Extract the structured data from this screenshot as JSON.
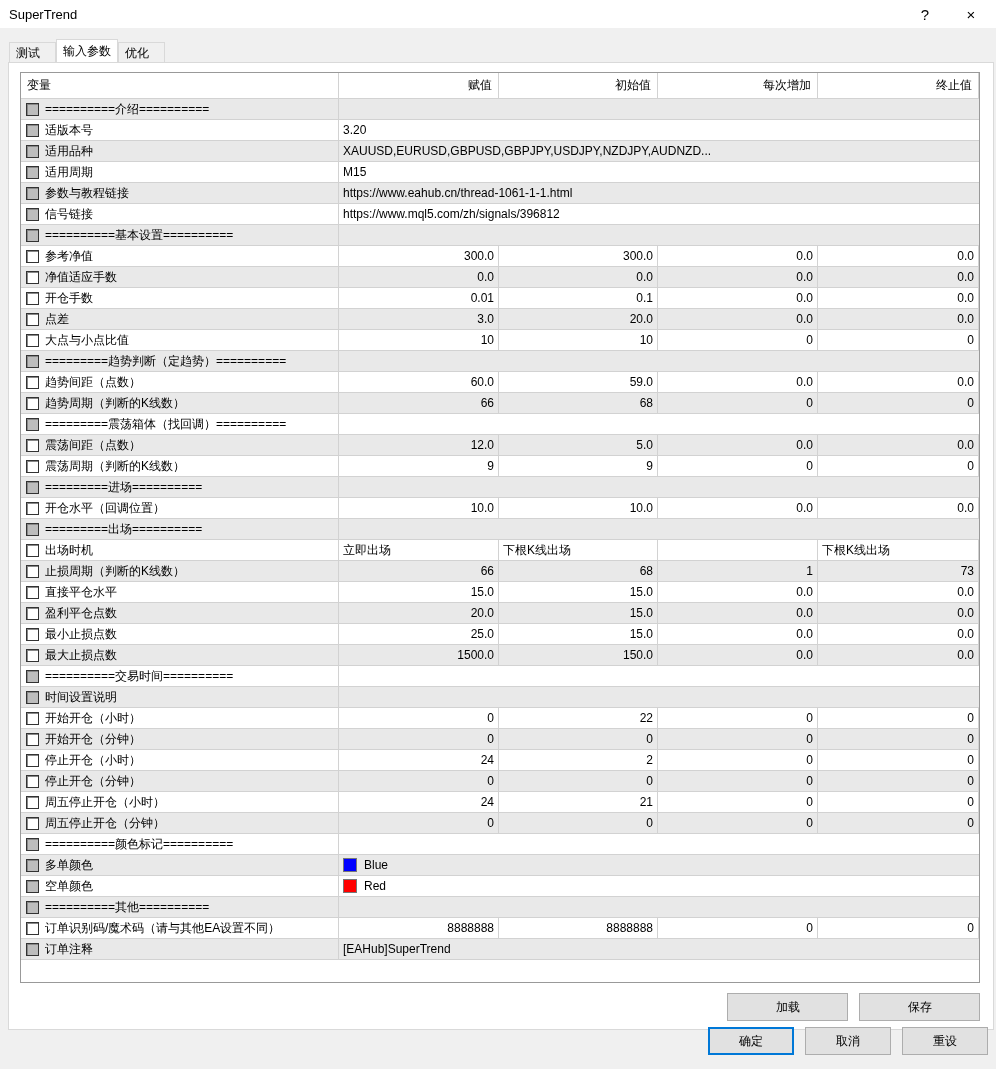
{
  "window": {
    "title": "SuperTrend",
    "help": "?",
    "close": "×"
  },
  "tabs": [
    {
      "label": "测试",
      "selected": false
    },
    {
      "label": "输入参数",
      "selected": true
    },
    {
      "label": "优化",
      "selected": false
    }
  ],
  "table": {
    "columns": [
      "变量",
      "赋值",
      "初始值",
      "每次增加",
      "终止值"
    ],
    "rows": [
      {
        "kind": "separator",
        "name": "==========介绍==========",
        "disabled": true
      },
      {
        "kind": "text",
        "name": "适版本号",
        "disabled": true,
        "value": "3.20"
      },
      {
        "kind": "text",
        "name": "适用品种",
        "disabled": true,
        "value": "XAUUSD,EURUSD,GBPUSD,GBPJPY,USDJPY,NZDJPY,AUDNZD..."
      },
      {
        "kind": "text",
        "name": "适用周期",
        "disabled": true,
        "value": "M15"
      },
      {
        "kind": "text",
        "name": "参数与教程链接",
        "disabled": true,
        "value": "https://www.eahub.cn/thread-1061-1-1.html"
      },
      {
        "kind": "text",
        "name": "信号链接",
        "disabled": true,
        "value": "https://www.mql5.com/zh/signals/396812"
      },
      {
        "kind": "separator",
        "name": "==========基本设置==========",
        "disabled": true
      },
      {
        "kind": "number",
        "name": "参考净值",
        "disabled": false,
        "values": [
          "300.0",
          "300.0",
          "0.0",
          "0.0"
        ]
      },
      {
        "kind": "number",
        "name": "净值适应手数",
        "disabled": false,
        "values": [
          "0.0",
          "0.0",
          "0.0",
          "0.0"
        ]
      },
      {
        "kind": "number",
        "name": "开仓手数",
        "disabled": false,
        "values": [
          "0.01",
          "0.1",
          "0.0",
          "0.0"
        ]
      },
      {
        "kind": "number",
        "name": "点差",
        "disabled": false,
        "values": [
          "3.0",
          "20.0",
          "0.0",
          "0.0"
        ]
      },
      {
        "kind": "number",
        "name": "大点与小点比值",
        "disabled": false,
        "values": [
          "10",
          "10",
          "0",
          "0"
        ]
      },
      {
        "kind": "separator",
        "name": "=========趋势判断（定趋势）==========",
        "disabled": true
      },
      {
        "kind": "number",
        "name": "趋势间距（点数）",
        "disabled": false,
        "values": [
          "60.0",
          "59.0",
          "0.0",
          "0.0"
        ]
      },
      {
        "kind": "number",
        "name": "趋势周期（判断的K线数）",
        "disabled": false,
        "values": [
          "66",
          "68",
          "0",
          "0"
        ]
      },
      {
        "kind": "separator",
        "name": "=========震荡箱体（找回调）==========",
        "disabled": true
      },
      {
        "kind": "number",
        "name": "震荡间距（点数）",
        "disabled": false,
        "values": [
          "12.0",
          "5.0",
          "0.0",
          "0.0"
        ]
      },
      {
        "kind": "number",
        "name": "震荡周期（判断的K线数）",
        "disabled": false,
        "values": [
          "9",
          "9",
          "0",
          "0"
        ]
      },
      {
        "kind": "separator",
        "name": "=========进场==========",
        "disabled": true
      },
      {
        "kind": "number",
        "name": "开仓水平（回调位置）",
        "disabled": false,
        "values": [
          "10.0",
          "10.0",
          "0.0",
          "0.0"
        ]
      },
      {
        "kind": "separator",
        "name": "=========出场==========",
        "disabled": true
      },
      {
        "kind": "choice",
        "name": "出场时机",
        "disabled": false,
        "values": {
          "assigned": "立即出场",
          "initial": "下根K线出场",
          "final": "下根K线出场"
        }
      },
      {
        "kind": "number",
        "name": "止损周期（判断的K线数）",
        "disabled": false,
        "values": [
          "66",
          "68",
          "1",
          "73"
        ]
      },
      {
        "kind": "number",
        "name": "直接平仓水平",
        "disabled": false,
        "values": [
          "15.0",
          "15.0",
          "0.0",
          "0.0"
        ]
      },
      {
        "kind": "number",
        "name": "盈利平仓点数",
        "disabled": false,
        "values": [
          "20.0",
          "15.0",
          "0.0",
          "0.0"
        ]
      },
      {
        "kind": "number",
        "name": "最小止损点数",
        "disabled": false,
        "values": [
          "25.0",
          "15.0",
          "0.0",
          "0.0"
        ]
      },
      {
        "kind": "number",
        "name": "最大止损点数",
        "disabled": false,
        "values": [
          "1500.0",
          "150.0",
          "0.0",
          "0.0"
        ]
      },
      {
        "kind": "separator",
        "name": "==========交易时间==========",
        "disabled": true
      },
      {
        "kind": "separator",
        "name": "时间设置说明",
        "disabled": true
      },
      {
        "kind": "number",
        "name": "开始开仓（小时）",
        "disabled": false,
        "values": [
          "0",
          "22",
          "0",
          "0"
        ]
      },
      {
        "kind": "number",
        "name": "开始开仓（分钟）",
        "disabled": false,
        "values": [
          "0",
          "0",
          "0",
          "0"
        ]
      },
      {
        "kind": "number",
        "name": "停止开仓（小时）",
        "disabled": false,
        "values": [
          "24",
          "2",
          "0",
          "0"
        ]
      },
      {
        "kind": "number",
        "name": "停止开仓（分钟）",
        "disabled": false,
        "values": [
          "0",
          "0",
          "0",
          "0"
        ]
      },
      {
        "kind": "number",
        "name": "周五停止开仓（小时）",
        "disabled": false,
        "values": [
          "24",
          "21",
          "0",
          "0"
        ]
      },
      {
        "kind": "number",
        "name": "周五停止开仓（分钟）",
        "disabled": false,
        "values": [
          "0",
          "0",
          "0",
          "0"
        ]
      },
      {
        "kind": "separator",
        "name": "==========颜色标记==========",
        "disabled": true
      },
      {
        "kind": "color",
        "name": "多单颜色",
        "disabled": true,
        "value": "Blue",
        "color": "#0000ff"
      },
      {
        "kind": "color",
        "name": "空单颜色",
        "disabled": true,
        "value": "Red",
        "color": "#ff0000"
      },
      {
        "kind": "separator",
        "name": "==========其他==========",
        "disabled": true
      },
      {
        "kind": "number",
        "name": "订单识别码/魔术码（请与其他EA设置不同）",
        "disabled": false,
        "values": [
          "8888888",
          "8888888",
          "0",
          "0"
        ]
      },
      {
        "kind": "text",
        "name": "订单注释",
        "disabled": true,
        "value": "[EAHub]SuperTrend"
      }
    ]
  },
  "panel_buttons": [
    "加载",
    "保存"
  ],
  "dialog_buttons": [
    {
      "label": "确定",
      "default": true
    },
    {
      "label": "取消",
      "default": false
    },
    {
      "label": "重设",
      "default": false
    }
  ]
}
